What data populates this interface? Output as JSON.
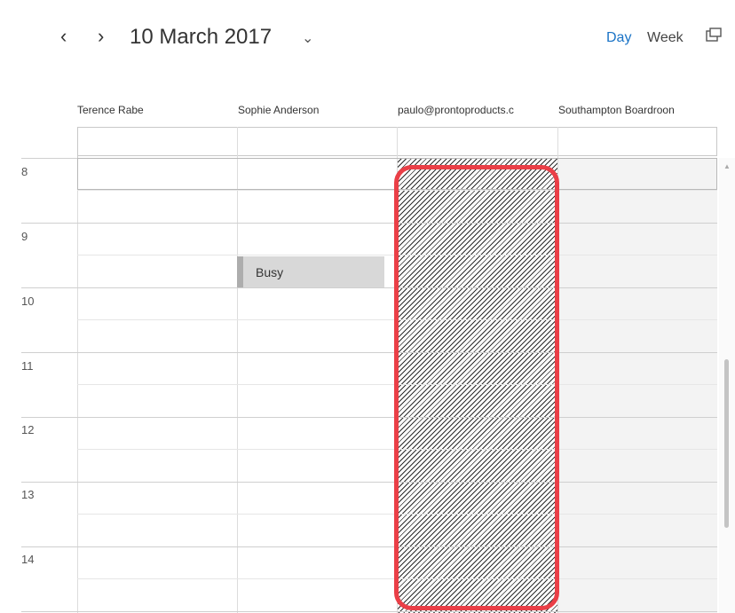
{
  "header": {
    "prev_icon": "chevron-left-icon",
    "prev_glyph": "‹",
    "next_icon": "chevron-right-icon",
    "next_glyph": "›",
    "date_title": "10 March 2017",
    "date_dropdown_glyph": "⌄",
    "views": {
      "day": "Day",
      "week": "Week"
    },
    "active_view": "Day",
    "popout_icon": "popout-window-icon"
  },
  "columns": [
    "Terence Rabe",
    "Sophie Anderson",
    "paulo@prontoproducts.c",
    "Southampton Boardroon"
  ],
  "hours": [
    "8",
    "9",
    "10",
    "11",
    "12",
    "13",
    "14"
  ],
  "events": [
    {
      "column": "Sophie Anderson",
      "label": "Busy",
      "status": "busy"
    }
  ],
  "colors": {
    "accent": "#1a73c6",
    "highlight": "#ea3f47",
    "busy_fill": "#d8d8d8",
    "busy_bar": "#adadad",
    "unavailable_hatch": "#2c2c2c",
    "room_column": "#f3f3f3"
  }
}
